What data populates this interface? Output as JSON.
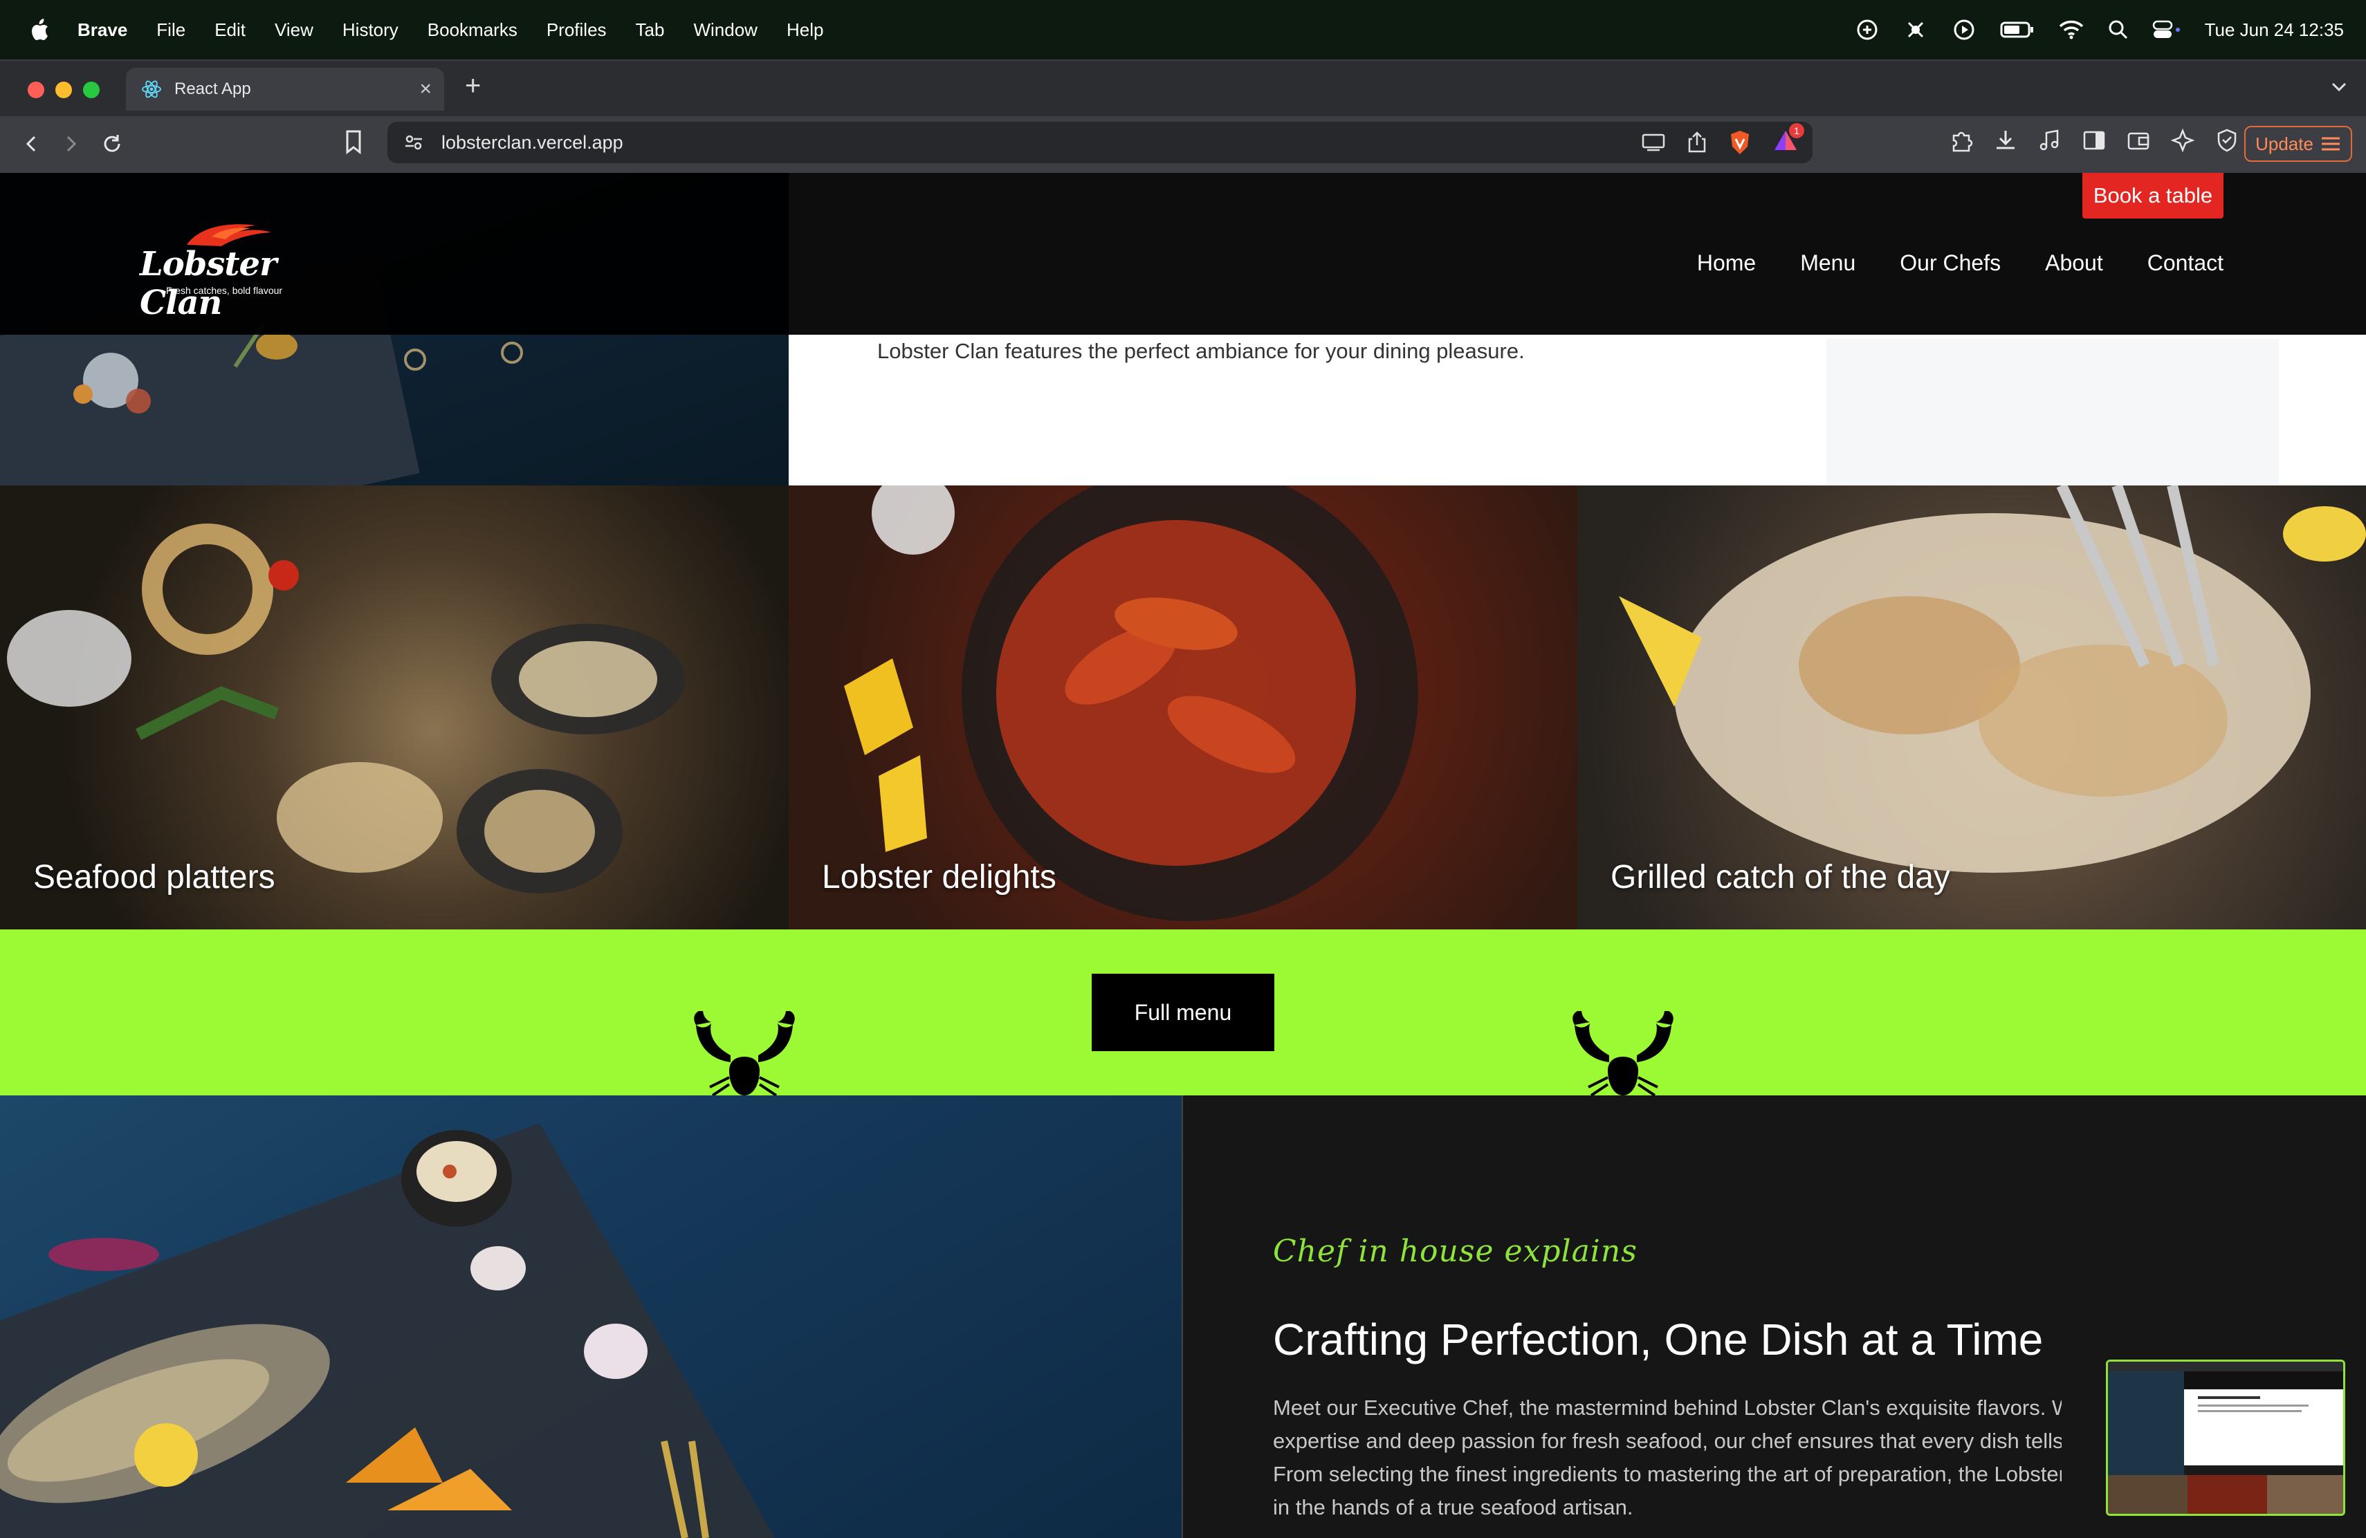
{
  "menubar": {
    "app_name": "Brave",
    "menus": [
      "File",
      "Edit",
      "View",
      "History",
      "Bookmarks",
      "Profiles",
      "Tab",
      "Window",
      "Help"
    ],
    "clock": "Tue Jun 24  12:35"
  },
  "browser": {
    "tab_title": "React App",
    "url": "lobsterclan.vercel.app",
    "update_label": "Update",
    "shield_badge": "1"
  },
  "site": {
    "logo_text": "Lobster Clan",
    "logo_tagline": "Fresh catches, bold flavour",
    "book_button": "Book a table",
    "nav": [
      "Home",
      "Menu",
      "Our Chefs",
      "About",
      "Contact"
    ],
    "hero_text": "Lobster Clan features the perfect ambiance for your dining pleasure.",
    "tiles": [
      "Seafood platters",
      "Lobster delights",
      "Grilled catch of the day"
    ],
    "full_menu_button": "Full menu",
    "chef": {
      "kicker": "Chef in house explains",
      "title": "Crafting Perfection, One Dish at a Time",
      "body_lines": [
        "Meet our Executive Chef, the mastermind behind Lobster Clan's exquisite flavors. With",
        "expertise and deep passion for fresh seafood, our chef ensures that every dish tells a sto",
        "From selecting the finest ingredients to mastering the art of preparation, the Lobster Cl",
        "in the hands of a true seafood artisan."
      ]
    }
  },
  "colors": {
    "accent_green": "#9cfa34",
    "book_red": "#e32621",
    "kicker_green": "#8fe43a"
  }
}
